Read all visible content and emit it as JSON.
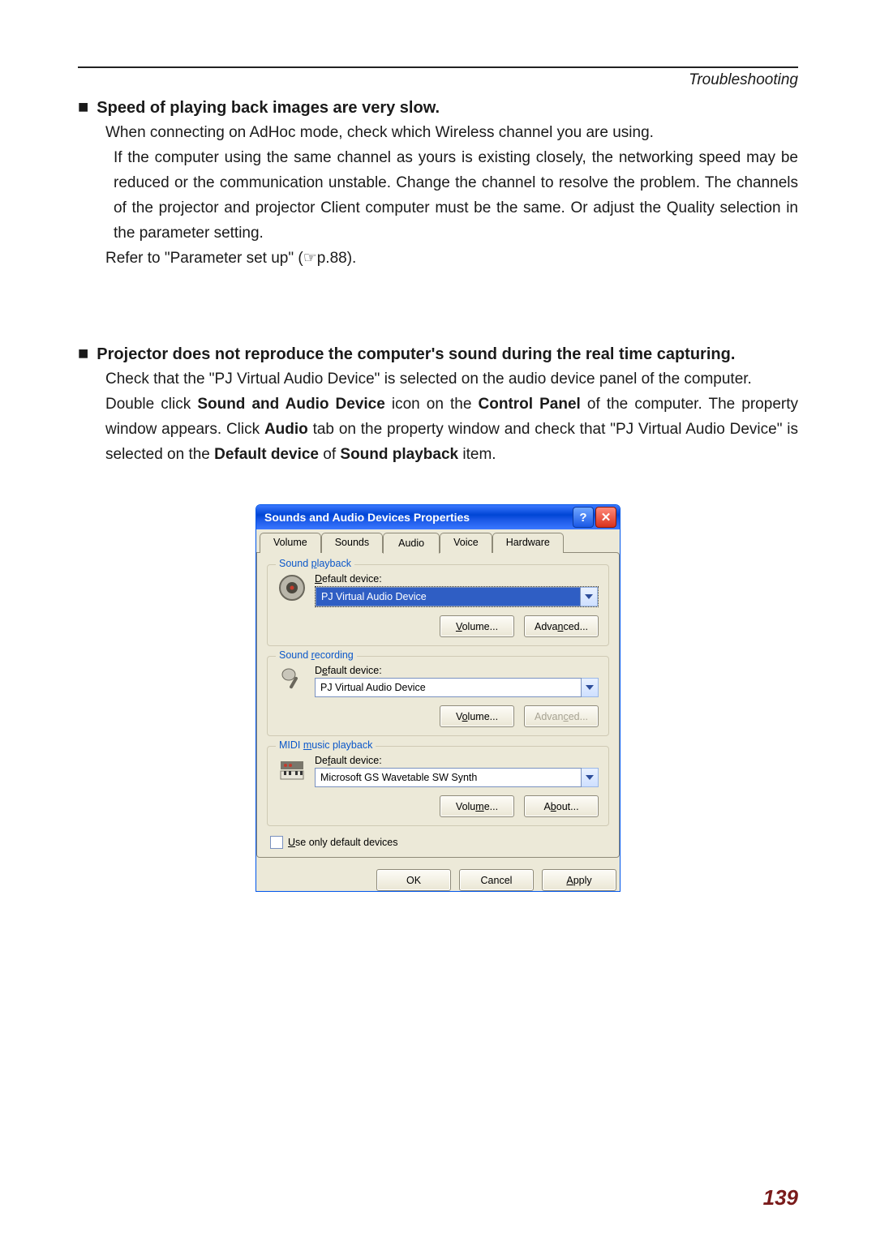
{
  "header": {
    "section": "Troubleshooting"
  },
  "blocks": {
    "speed": {
      "title": "Speed of playing back images are very slow.",
      "lines": [
        "When connecting on AdHoc mode, check which Wireless channel you are using.",
        "If the computer using the same channel as yours is existing closely, the networking speed may be reduced or the communication unstable. Change the channel to resolve the problem. The channels of the projector and projector Client computer must be the same. Or adjust the Quality selection in the parameter setting.",
        "Refer to \"Parameter set up\" (☞p.88)."
      ]
    },
    "audio": {
      "title": "Projector does not reproduce the computer's sound during the real time capturing.",
      "para": {
        "p1": "Check that the \"PJ Virtual Audio Device\" is selected on the audio device panel of the computer.",
        "p2a": "Double click ",
        "p2b": "Sound and Audio Device",
        "p2c": " icon on the ",
        "p2d": "Control Panel",
        "p2e": " of the computer. The property window appears. Click ",
        "p2f": "Audio",
        "p2g": " tab on the property window and check that \"PJ Virtual Audio Device\" is selected on the ",
        "p2h": "Default device",
        "p2i": "  of ",
        "p2j": "Sound playback",
        "p2k": " item."
      }
    }
  },
  "dialog": {
    "title": "Sounds and Audio Devices Properties",
    "tabs": [
      "Volume",
      "Sounds",
      "Audio",
      "Voice",
      "Hardware"
    ],
    "activeTab": "Audio",
    "groups": {
      "playback": {
        "legend": "Sound playback",
        "label": "Default device:",
        "value": "PJ Virtual Audio Device",
        "buttons": {
          "volume": "Volume...",
          "advanced": "Advanced..."
        }
      },
      "recording": {
        "legend": "Sound recording",
        "label": "Default device:",
        "value": "PJ Virtual Audio Device",
        "buttons": {
          "volume": "Volume...",
          "advanced": "Advanced..."
        }
      },
      "midi": {
        "legend": "MIDI music playback",
        "label": "Default device:",
        "value": "Microsoft GS Wavetable SW Synth",
        "buttons": {
          "volume": "Volume...",
          "about": "About..."
        }
      }
    },
    "useDefault": "Use only default devices",
    "actions": {
      "ok": "OK",
      "cancel": "Cancel",
      "apply": "Apply"
    }
  },
  "pageNumber": "139"
}
